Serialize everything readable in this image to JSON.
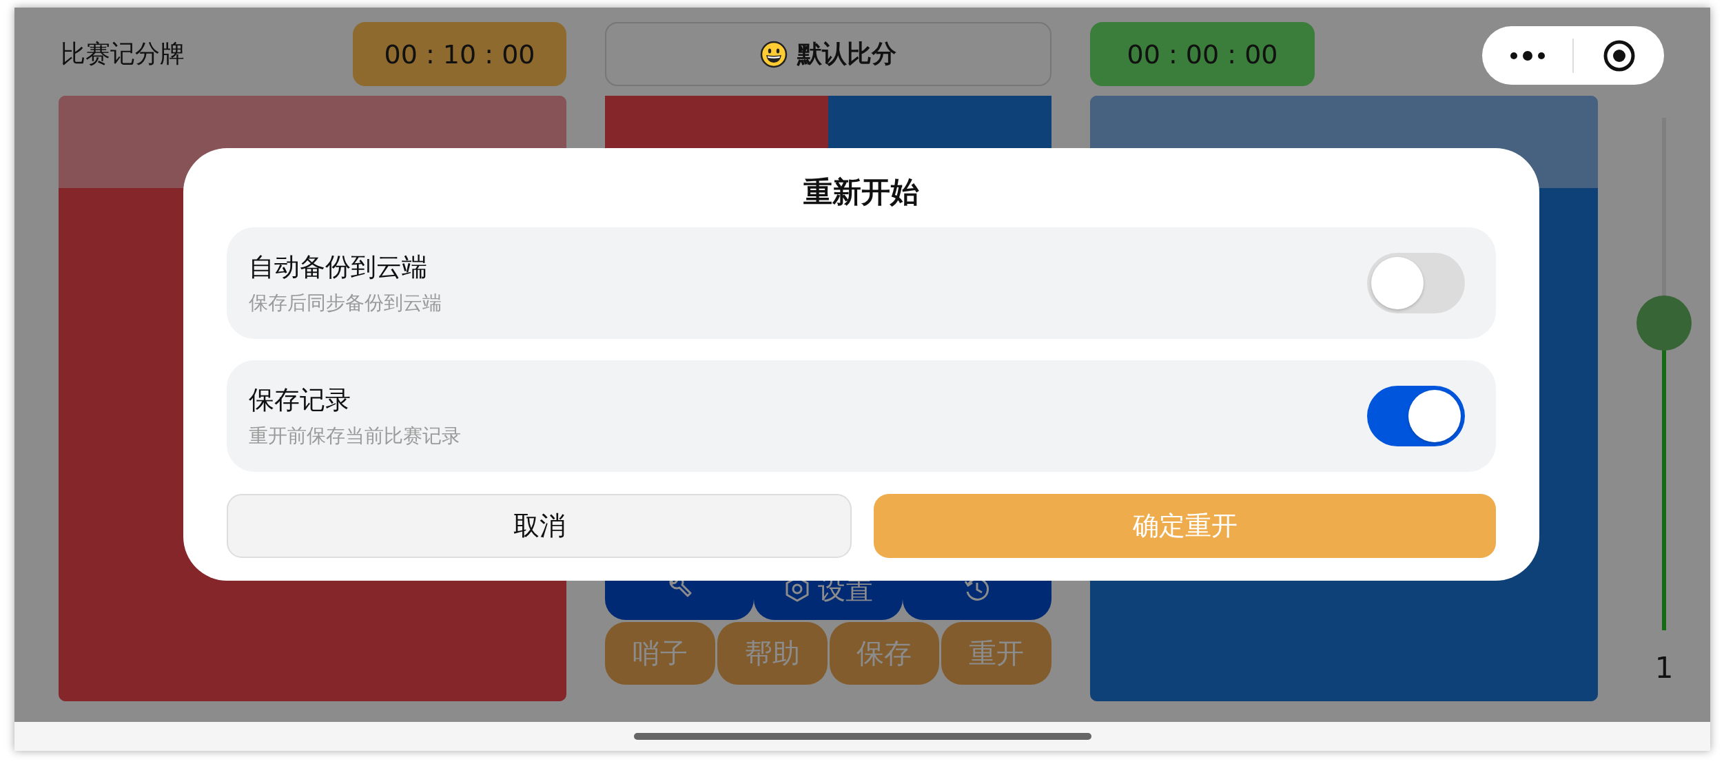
{
  "header": {
    "title": "比赛记分牌",
    "countdown": "00 : 10 : 00",
    "score_mode": "默认比分",
    "elapsed": "00 : 00 : 00"
  },
  "teams": [
    {
      "color": "#85262a"
    },
    {
      "color": "#0d4177"
    }
  ],
  "tools": [
    {
      "label": "设置"
    }
  ],
  "actions": [
    "哨子",
    "帮助",
    "保存",
    "重开"
  ],
  "slider": {
    "level": 0.6,
    "reading": "1"
  },
  "dialog": {
    "title": "重新开始",
    "options": [
      {
        "label": "自动备份到云端",
        "description": "保存后同步备份到云端",
        "on": false
      },
      {
        "label": "保存记录",
        "description": "重开前保存当前比赛记录",
        "on": true
      }
    ],
    "buttons": [
      {
        "label": "取消",
        "kind": "secondary"
      },
      {
        "label": "确定重开",
        "kind": "primary"
      }
    ]
  }
}
